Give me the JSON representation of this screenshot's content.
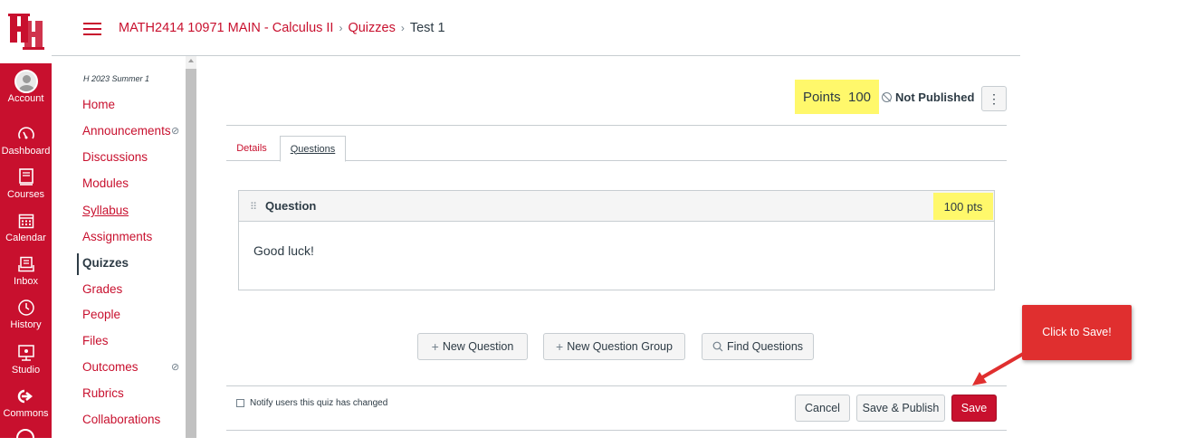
{
  "header": {
    "breadcrumb": [
      "MATH2414 10971 MAIN - Calculus II",
      "Quizzes",
      "Test 1"
    ]
  },
  "global_nav": [
    {
      "label": "Account",
      "icon": "account-avatar-icon"
    },
    {
      "label": "Dashboard",
      "icon": "dashboard-gauge-icon"
    },
    {
      "label": "Courses",
      "icon": "courses-book-icon"
    },
    {
      "label": "Calendar",
      "icon": "calendar-icon"
    },
    {
      "label": "Inbox",
      "icon": "inbox-icon"
    },
    {
      "label": "History",
      "icon": "clock-icon"
    },
    {
      "label": "Studio",
      "icon": "studio-icon"
    },
    {
      "label": "Commons",
      "icon": "commons-icon"
    }
  ],
  "course_nav": {
    "term": "H 2023 Summer 1",
    "items": [
      "Home",
      "Announcements",
      "Discussions",
      "Modules",
      "Syllabus",
      "Assignments",
      "Quizzes",
      "Grades",
      "People",
      "Files",
      "Outcomes",
      "Rubrics",
      "Collaborations"
    ],
    "active": "Quizzes"
  },
  "quiz": {
    "points_label": "Points",
    "points_value": "100",
    "status": "Not Published",
    "kebab": "⋮",
    "tabs": [
      "Details",
      "Questions"
    ],
    "active_tab": "Questions"
  },
  "question": {
    "title": "Question",
    "points": "100 pts",
    "text": "Good luck!"
  },
  "actions": {
    "new_question": "New Question",
    "new_question_group": "New Question Group",
    "find_questions": "Find Questions",
    "notify_label": "Notify users this quiz has changed",
    "notify_checked": false,
    "cancel": "Cancel",
    "save_publish": "Save & Publish",
    "save": "Save"
  },
  "annotation": {
    "callout": "Click to Save!"
  },
  "colors": {
    "brand": "#c8102e",
    "highlight": "#fff86b",
    "callout": "#e02f2f"
  }
}
